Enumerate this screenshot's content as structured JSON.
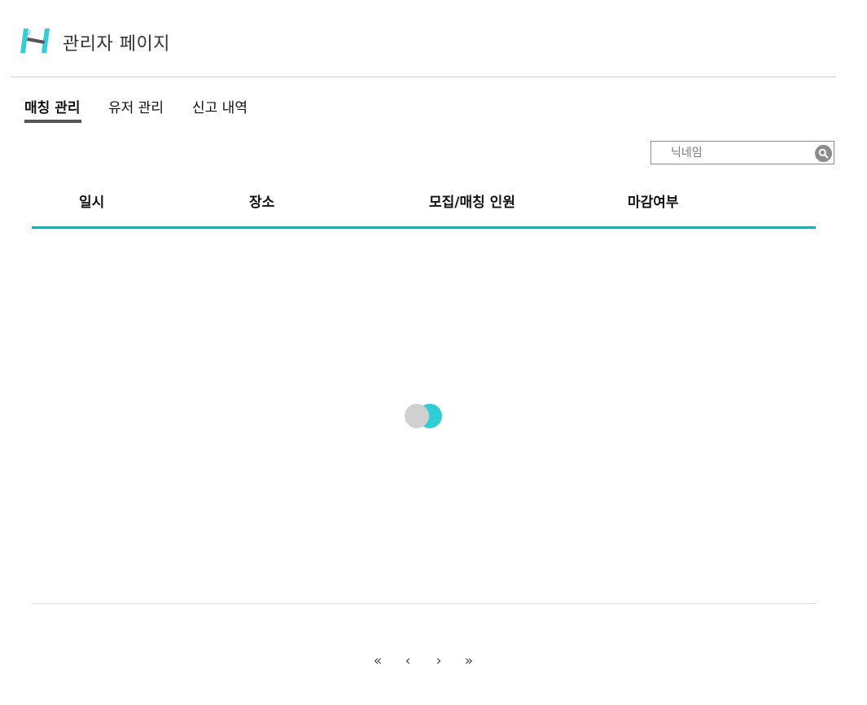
{
  "header": {
    "title": "관리자 페이지",
    "logo_icon": "logo-h-icon",
    "logo_color": "#33cdd5"
  },
  "tabs": [
    {
      "label": "매칭 관리",
      "active": true
    },
    {
      "label": "유저 관리",
      "active": false
    },
    {
      "label": "신고 내역",
      "active": false
    }
  ],
  "search": {
    "placeholder": "닉네임",
    "value": "",
    "icon": "search-icon"
  },
  "table": {
    "columns": [
      "일시",
      "장소",
      "모집/매칭 인원",
      "마감여부"
    ],
    "rows": [],
    "accent_color": "#2ba8ad"
  },
  "loading": {
    "icon": "loading-spinner-icon",
    "colors": [
      "#d0d0d0",
      "#33cdd5"
    ]
  },
  "pagination": {
    "first": "«",
    "prev": "‹",
    "next": "›",
    "last": "»"
  }
}
